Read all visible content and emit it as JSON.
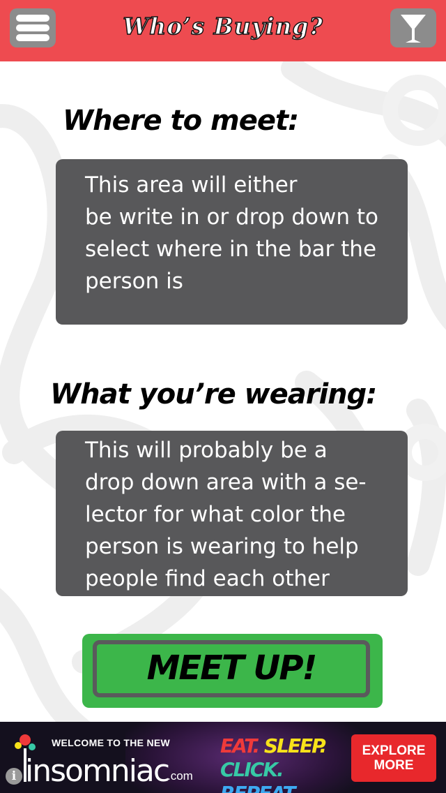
{
  "header": {
    "title": "Who’s Buying?",
    "menu_icon": "hamburger-menu-icon",
    "drink_icon": "martini-glass-icon",
    "background_color": "#ee4b50"
  },
  "where": {
    "label": "Where to meet:",
    "box_lines": [
      "This area will either",
      "be write in or drop down to",
      "select where in the bar the",
      "person is"
    ]
  },
  "wearing": {
    "label": "What you’re wearing:",
    "box_lines": [
      "This will probably be a",
      "drop down area with a se-",
      "lector for what color the",
      "person is wearing to help",
      "people find each other"
    ]
  },
  "meet_button": {
    "label": "MEET UP!",
    "color": "#3cb64a"
  },
  "ad": {
    "welcome": "WELCOME TO THE NEW",
    "brand": "insomniac",
    "brand_suffix": ".com",
    "slogan": {
      "eat": "EAT.",
      "sleep": "SLEEP.",
      "click": "CLICK.",
      "repeat": "REPEAT."
    },
    "cta_line1": "EXPLORE",
    "cta_line2": "MORE",
    "info_symbol": "i"
  }
}
